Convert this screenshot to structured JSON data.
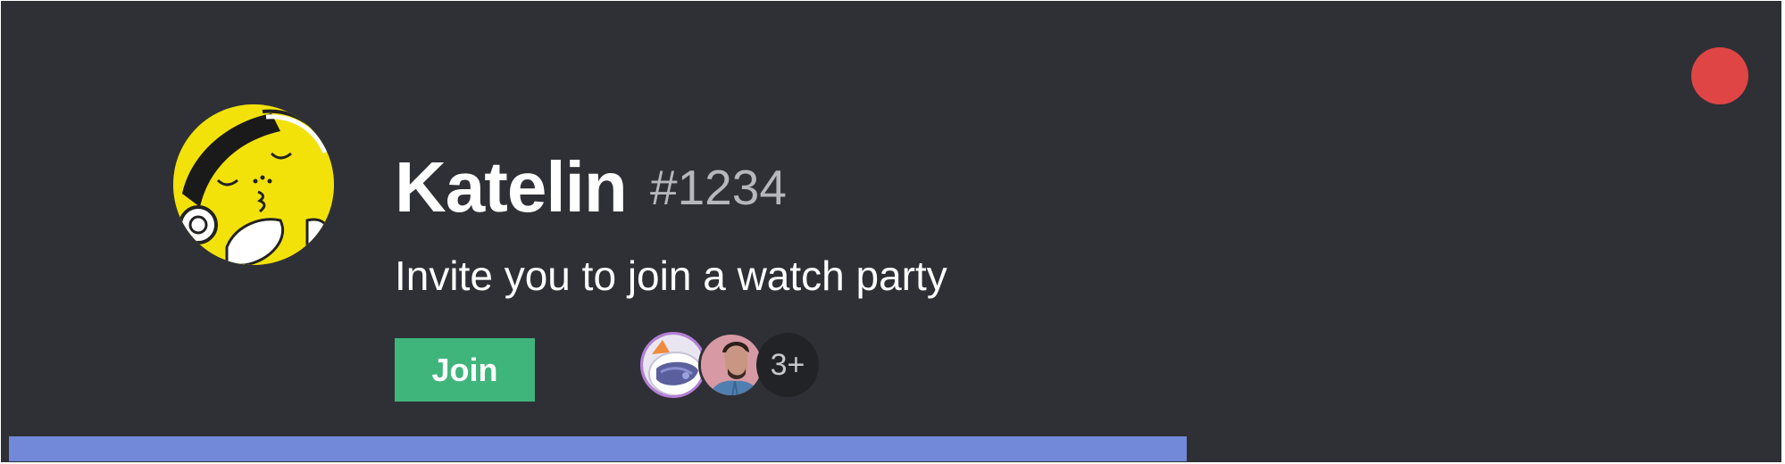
{
  "invite": {
    "username": "Katelin",
    "discriminator": "#1234",
    "message": "Invite you to join a watch party",
    "join_label": "Join",
    "participants_more": "3+",
    "progress_fraction": 0.665
  },
  "colors": {
    "card_background": "#2f3036",
    "close_dot": "#df4545",
    "join_button": "#3fb57b",
    "progress_bar": "#7289da",
    "tag_text": "#b5b7bd"
  },
  "icons": {
    "close": "red-dot-close-icon",
    "user_avatar": "cartoon-avatar-icon"
  }
}
